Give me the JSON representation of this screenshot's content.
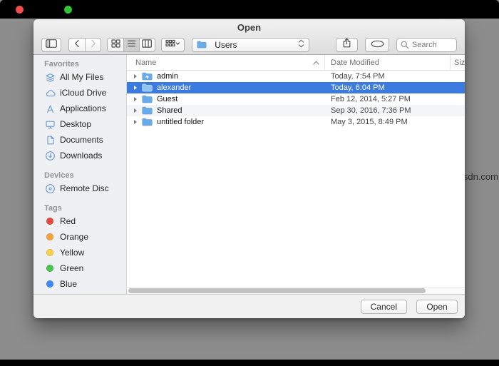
{
  "chrome": {
    "window_buttons": [
      "close",
      "zoom"
    ]
  },
  "watermark": "wsdn.com",
  "dialog": {
    "title": "Open",
    "toolbar": {
      "sidebar_toggle_icon": "sidebar-panel-icon",
      "back_icon": "chevron-left-icon",
      "forward_icon": "chevron-right-icon",
      "view_modes": [
        {
          "label": "icon view",
          "icon": "icon-view-icon",
          "selected": false
        },
        {
          "label": "list view",
          "icon": "list-view-icon",
          "selected": true
        },
        {
          "label": "column view",
          "icon": "column-view-icon",
          "selected": false
        }
      ],
      "arrange_icon": "arrange-grid-icon",
      "path_control": {
        "icon": "folder-icon",
        "value": "Users"
      },
      "share_icon": "share-icon",
      "tags_icon": "tags-oval-icon",
      "search": {
        "icon": "magnifier-icon",
        "placeholder": "Search"
      }
    },
    "sidebar": {
      "sections": [
        {
          "label": "Favorites",
          "items": [
            {
              "label": "All My Files",
              "icon": "all-my-files-icon"
            },
            {
              "label": "iCloud Drive",
              "icon": "icloud-icon"
            },
            {
              "label": "Applications",
              "icon": "applications-icon"
            },
            {
              "label": "Desktop",
              "icon": "desktop-icon"
            },
            {
              "label": "Documents",
              "icon": "documents-icon"
            },
            {
              "label": "Downloads",
              "icon": "downloads-icon"
            }
          ]
        },
        {
          "label": "Devices",
          "items": [
            {
              "label": "Remote Disc",
              "icon": "remote-disc-icon"
            }
          ]
        },
        {
          "label": "Tags",
          "items": [
            {
              "label": "Red",
              "color": "#e5493f"
            },
            {
              "label": "Orange",
              "color": "#f7a239"
            },
            {
              "label": "Yellow",
              "color": "#f8cf46"
            },
            {
              "label": "Green",
              "color": "#47c64c"
            },
            {
              "label": "Blue",
              "color": "#3f87f5"
            }
          ]
        }
      ]
    },
    "file_list": {
      "columns": [
        {
          "label": "Name"
        },
        {
          "label": "Date Modified"
        },
        {
          "label": "Size"
        }
      ],
      "sort_column": "Name",
      "sort_direction": "ascending",
      "rows": [
        {
          "name": "admin",
          "date_modified": "Today, 7:54 PM",
          "icon": "folder-up-icon",
          "selected": false
        },
        {
          "name": "alexander",
          "date_modified": "Today, 6:04 PM",
          "icon": "folder-icon",
          "selected": true
        },
        {
          "name": "Guest",
          "date_modified": "Feb 12, 2014, 5:27 PM",
          "icon": "folder-icon",
          "selected": false
        },
        {
          "name": "Shared",
          "date_modified": "Sep 30, 2016, 7:36 PM",
          "icon": "folder-icon",
          "selected": false
        },
        {
          "name": "untitled folder",
          "date_modified": "May 3, 2015, 8:49 PM",
          "icon": "folder-icon",
          "selected": false
        }
      ]
    },
    "footer": {
      "cancel_label": "Cancel",
      "open_label": "Open"
    }
  },
  "colors": {
    "selection_blue": "#3b7adf",
    "sidebar_icon_blue": "#6e9bd3",
    "folder_blue": "#69abe9",
    "tag_red": "#e5493f",
    "tag_orange": "#f7a239",
    "tag_yellow": "#f8cf46",
    "tag_green": "#47c64c",
    "tag_blue": "#3f87f5"
  }
}
